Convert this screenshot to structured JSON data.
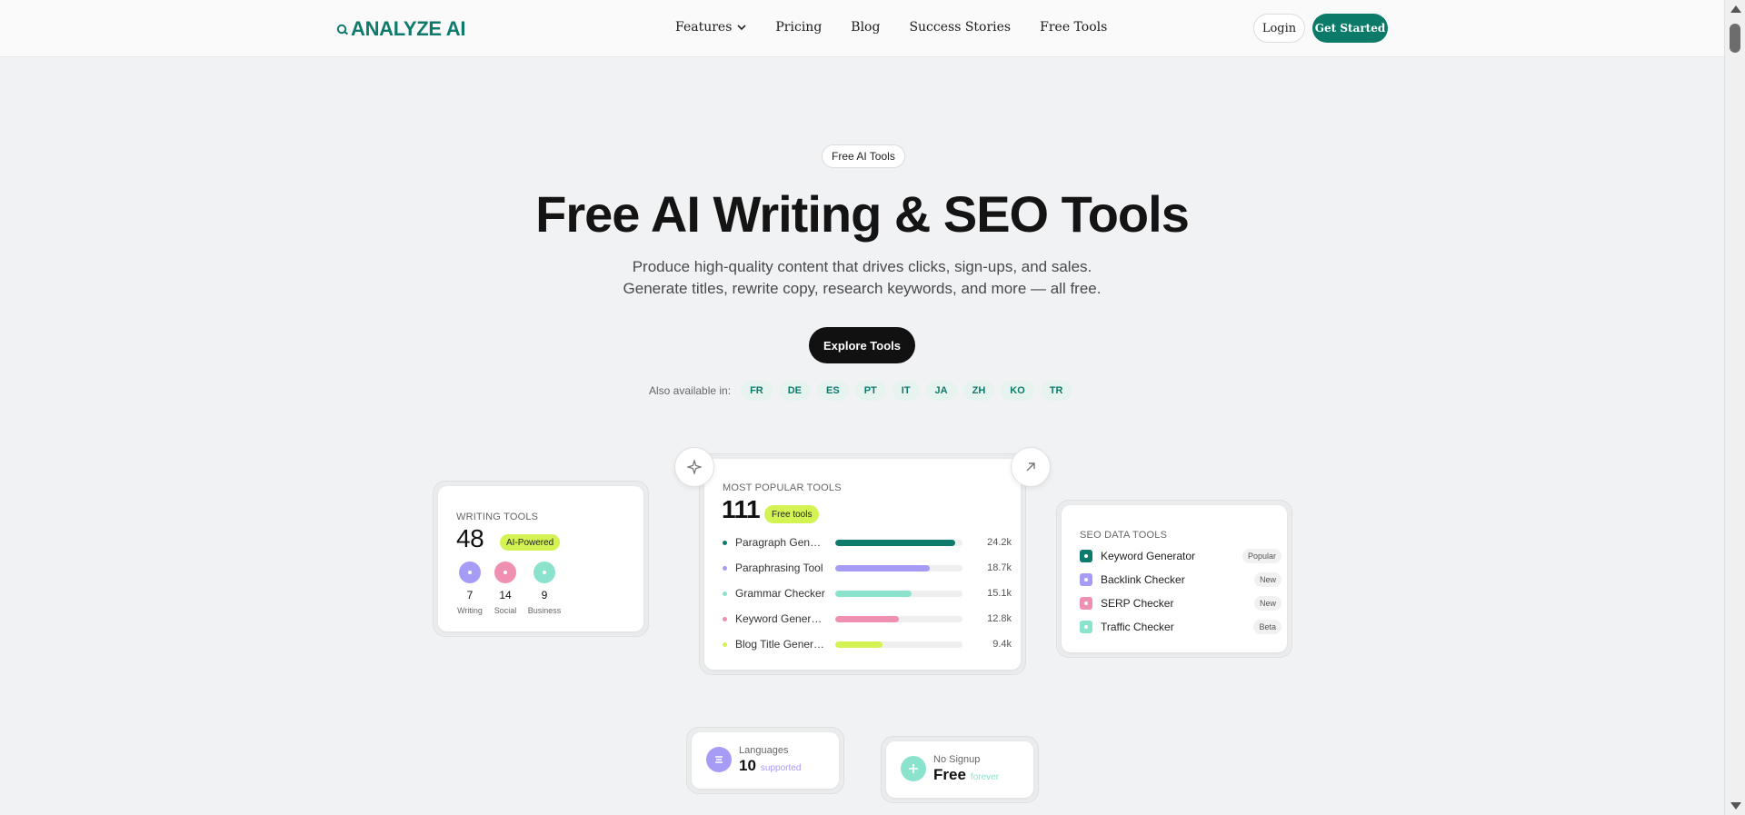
{
  "brand": {
    "name": "ANALYZE AI",
    "color": "#0e7a6c"
  },
  "nav": {
    "links": [
      "Features",
      "Pricing",
      "Blog",
      "Success Stories",
      "Free Tools"
    ],
    "login": "Login",
    "get_started": "Get Started"
  },
  "hero": {
    "tag": "Free AI Tools",
    "title": "Free AI Writing & SEO Tools",
    "sub_line1": "Produce high-quality content that drives clicks, sign-ups, and sales.",
    "sub_line2": "Generate titles, rewrite copy, research keywords, and more — all free.",
    "cta": "Explore Tools",
    "langs_label": "Also available in:",
    "langs": [
      "FR",
      "DE",
      "ES",
      "PT",
      "IT",
      "JA",
      "ZH",
      "KO",
      "TR"
    ]
  },
  "writing_tools": {
    "label": "WRITING TOOLS",
    "count": "48",
    "badge": "AI-Powered",
    "categories": [
      {
        "count": "7",
        "name": "Writing",
        "color": "#a79cf5"
      },
      {
        "count": "14",
        "name": "Social",
        "color": "#ef8fb2"
      },
      {
        "count": "9",
        "name": "Business",
        "color": "#8be3cd"
      }
    ]
  },
  "popular_tools": {
    "label": "MOST POPULAR TOOLS",
    "count": "111",
    "badge": "Free tools",
    "tools": [
      {
        "name": "Paragraph Generator",
        "value": "24.2k",
        "share": 0.94,
        "color": "#0e7a6c"
      },
      {
        "name": "Paraphrasing Tool",
        "value": "18.7k",
        "share": 0.74,
        "color": "#a79cf5"
      },
      {
        "name": "Grammar Checker",
        "value": "15.1k",
        "share": 0.6,
        "color": "#8be3cd"
      },
      {
        "name": "Keyword Generator",
        "value": "12.8k",
        "share": 0.5,
        "color": "#ef8fb2"
      },
      {
        "name": "Blog Title Generator",
        "value": "9.4k",
        "share": 0.37,
        "color": "#d3f353"
      }
    ]
  },
  "seo_tools": {
    "label": "SEO DATA TOOLS",
    "items": [
      {
        "name": "Keyword Generator",
        "tag": "Popular",
        "color": "#0e7a6c"
      },
      {
        "name": "Backlink Checker",
        "tag": "New",
        "color": "#a79cf5"
      },
      {
        "name": "SERP Checker",
        "tag": "New",
        "color": "#ef8fb2"
      },
      {
        "name": "Traffic Checker",
        "tag": "Beta",
        "color": "#8be3cd"
      }
    ]
  },
  "stats": {
    "languages": {
      "label": "Languages",
      "value": "10",
      "suffix": "supported",
      "color": "#a79cf5"
    },
    "signup": {
      "label": "No Signup",
      "value": "Free",
      "suffix": "forever",
      "color": "#8be3cd"
    }
  },
  "icons": {
    "float_left": "sparkle-icon",
    "float_right": "arrow-up-right-icon"
  }
}
